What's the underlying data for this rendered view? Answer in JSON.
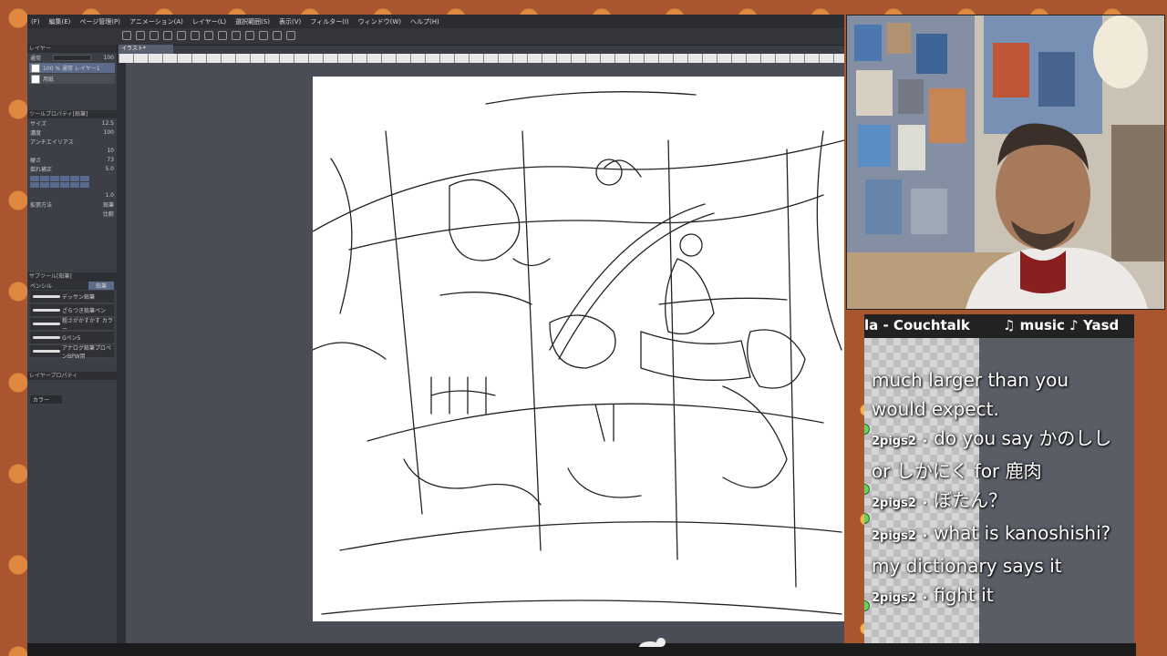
{
  "app": {
    "menu": [
      "(F)",
      "編集(E)",
      "ページ管理(P)",
      "アニメーション(A)",
      "レイヤー(L)",
      "選択範囲(S)",
      "表示(V)",
      "フィルター(I)",
      "ウィンドウ(W)",
      "ヘルプ(H)"
    ],
    "canvas_tab": "イラスト*",
    "layer_panel": {
      "title": "レイヤー",
      "blend_mode": "通常",
      "opacity": "100",
      "layers": [
        {
          "name": "100 % 通常 レイヤー1",
          "active": true
        },
        {
          "name": "用紙",
          "active": false
        }
      ]
    },
    "tool_property": {
      "title": "ツールプロパティ[鉛筆]",
      "rows": [
        {
          "label": "サイズ",
          "value": "12.5"
        },
        {
          "label": "濃度",
          "value": "100"
        },
        {
          "label": "アンチエイリアス",
          "value": ""
        },
        {
          "label": "",
          "value": "10"
        },
        {
          "label": "硬さ",
          "value": "73"
        },
        {
          "label": "揺れ補正",
          "value": "5.0"
        },
        {
          "label": "",
          "value": "1.0"
        },
        {
          "label": "拡張方法",
          "value": "鉛筆"
        },
        {
          "label": "",
          "value": "比較"
        }
      ]
    },
    "sub_tool": {
      "title": "サブツール[鉛筆]",
      "tabs": [
        "ペンシル",
        "鉛筆"
      ],
      "brushes": [
        "デッサン鉛筆",
        "ざらつき鉛筆ペン",
        "粗さがかすかす カラー",
        "Gペン5",
        "アナログ鉛筆プロペンBPW用"
      ]
    },
    "layer_property": {
      "title": "レイヤープロパティ",
      "dropdown": "カラー"
    }
  },
  "ticker": {
    "left_text": "la - Couchtalk",
    "right_text": "♫ music ♪ Yasd"
  },
  "chat": {
    "messages": [
      {
        "user": "",
        "text": "much larger than you"
      },
      {
        "user": "",
        "text": "would expect."
      },
      {
        "user": "2pigs2",
        "text": "do you say かのしし or しかにく for 鹿肉"
      },
      {
        "user": "2pigs2",
        "text": "ぼたん？"
      },
      {
        "user": "2pigs2",
        "text": "what is kanoshishi? my dictionary says it"
      },
      {
        "user": "2pigs2",
        "text": "fight it"
      }
    ],
    "separator": "•"
  },
  "colors": {
    "app_bg": "#3a3d44",
    "panel_bg": "#3c3f46",
    "accent": "#5d6b8a",
    "frame": "#a9552f",
    "chat_badge": "#6ad15f"
  }
}
